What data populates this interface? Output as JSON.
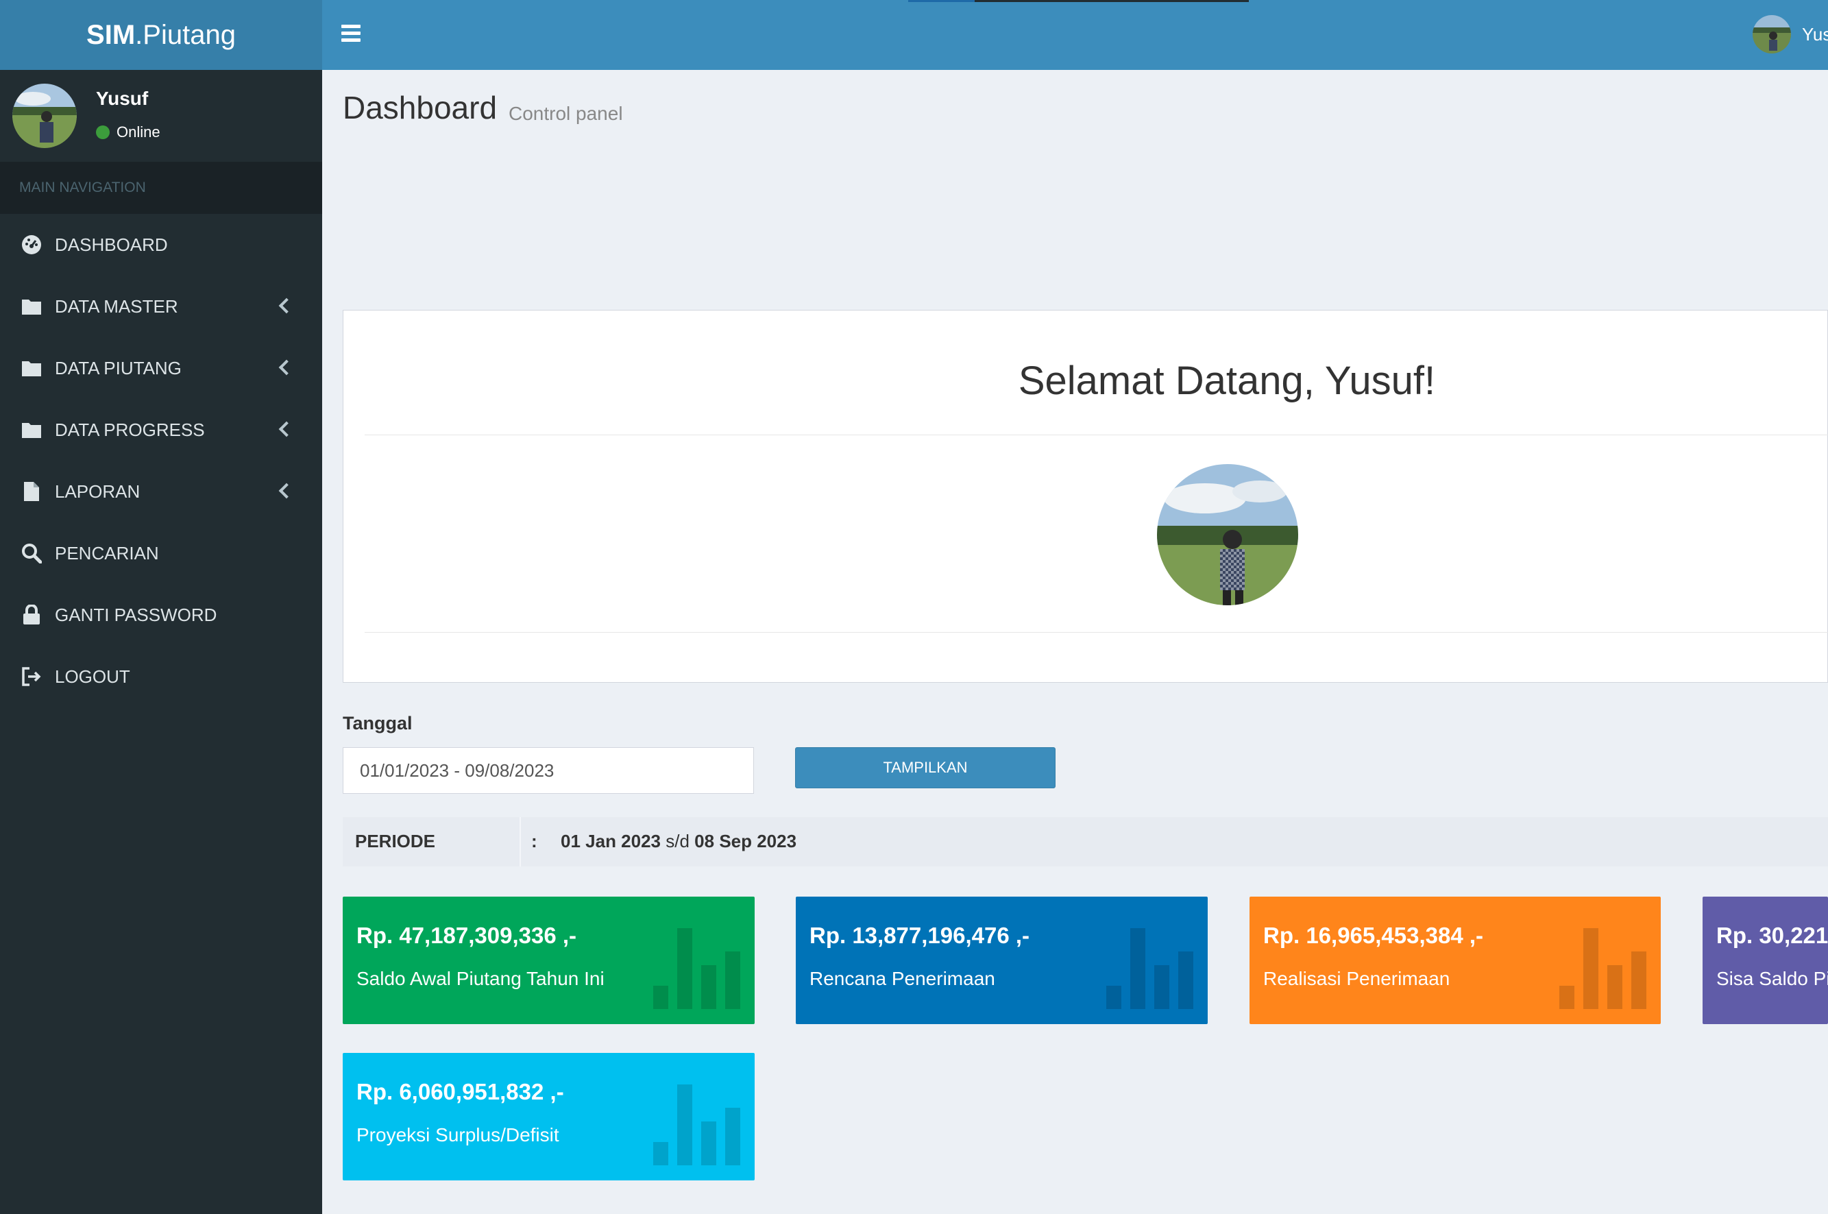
{
  "app": {
    "logo_bold": "SIM",
    "logo_rest": ".Piutang"
  },
  "navbar": {
    "user_name": "Yus"
  },
  "sidebar": {
    "user": {
      "name": "Yusuf",
      "status": "Online"
    },
    "header": "MAIN NAVIGATION",
    "items": [
      {
        "label": "DASHBOARD",
        "icon": "dashboard-icon"
      },
      {
        "label": "DATA MASTER",
        "icon": "folder-icon"
      },
      {
        "label": "DATA PIUTANG",
        "icon": "folder-icon"
      },
      {
        "label": "DATA PROGRESS",
        "icon": "folder-icon"
      },
      {
        "label": "LAPORAN",
        "icon": "file-icon"
      },
      {
        "label": "PENCARIAN",
        "icon": "search-icon"
      },
      {
        "label": "GANTI PASSWORD",
        "icon": "lock-icon"
      },
      {
        "label": "LOGOUT",
        "icon": "logout-icon"
      }
    ]
  },
  "page": {
    "title": "Dashboard",
    "subtitle": "Control panel"
  },
  "welcome": {
    "title": "Selamat Datang, Yusuf!"
  },
  "filter": {
    "label": "Tanggal",
    "value": "01/01/2023 - 09/08/2023",
    "button": "TAMPILKAN"
  },
  "periode": {
    "label": "PERIODE",
    "colon": ":",
    "start": "01 Jan 2023",
    "sep": "s/d",
    "end": "08 Sep 2023"
  },
  "cards": [
    {
      "amount": "Rp. 47,187,309,336 ,-",
      "label": "Saldo Awal Piutang Tahun Ini",
      "color": "#00a65a"
    },
    {
      "amount": "Rp. 13,877,196,476 ,-",
      "label": "Rencana Penerimaan",
      "color": "#0073b7"
    },
    {
      "amount": "Rp. 16,965,453,384 ,-",
      "label": "Realisasi Penerimaan",
      "color": "#ff851b"
    },
    {
      "amount": "Rp. 30,221",
      "label": "Sisa Saldo Pi",
      "color": "#605ca8"
    },
    {
      "amount": "Rp. 6,060,951,832 ,-",
      "label": "Proyeksi Surplus/Defisit",
      "color": "#00c0ef"
    }
  ]
}
